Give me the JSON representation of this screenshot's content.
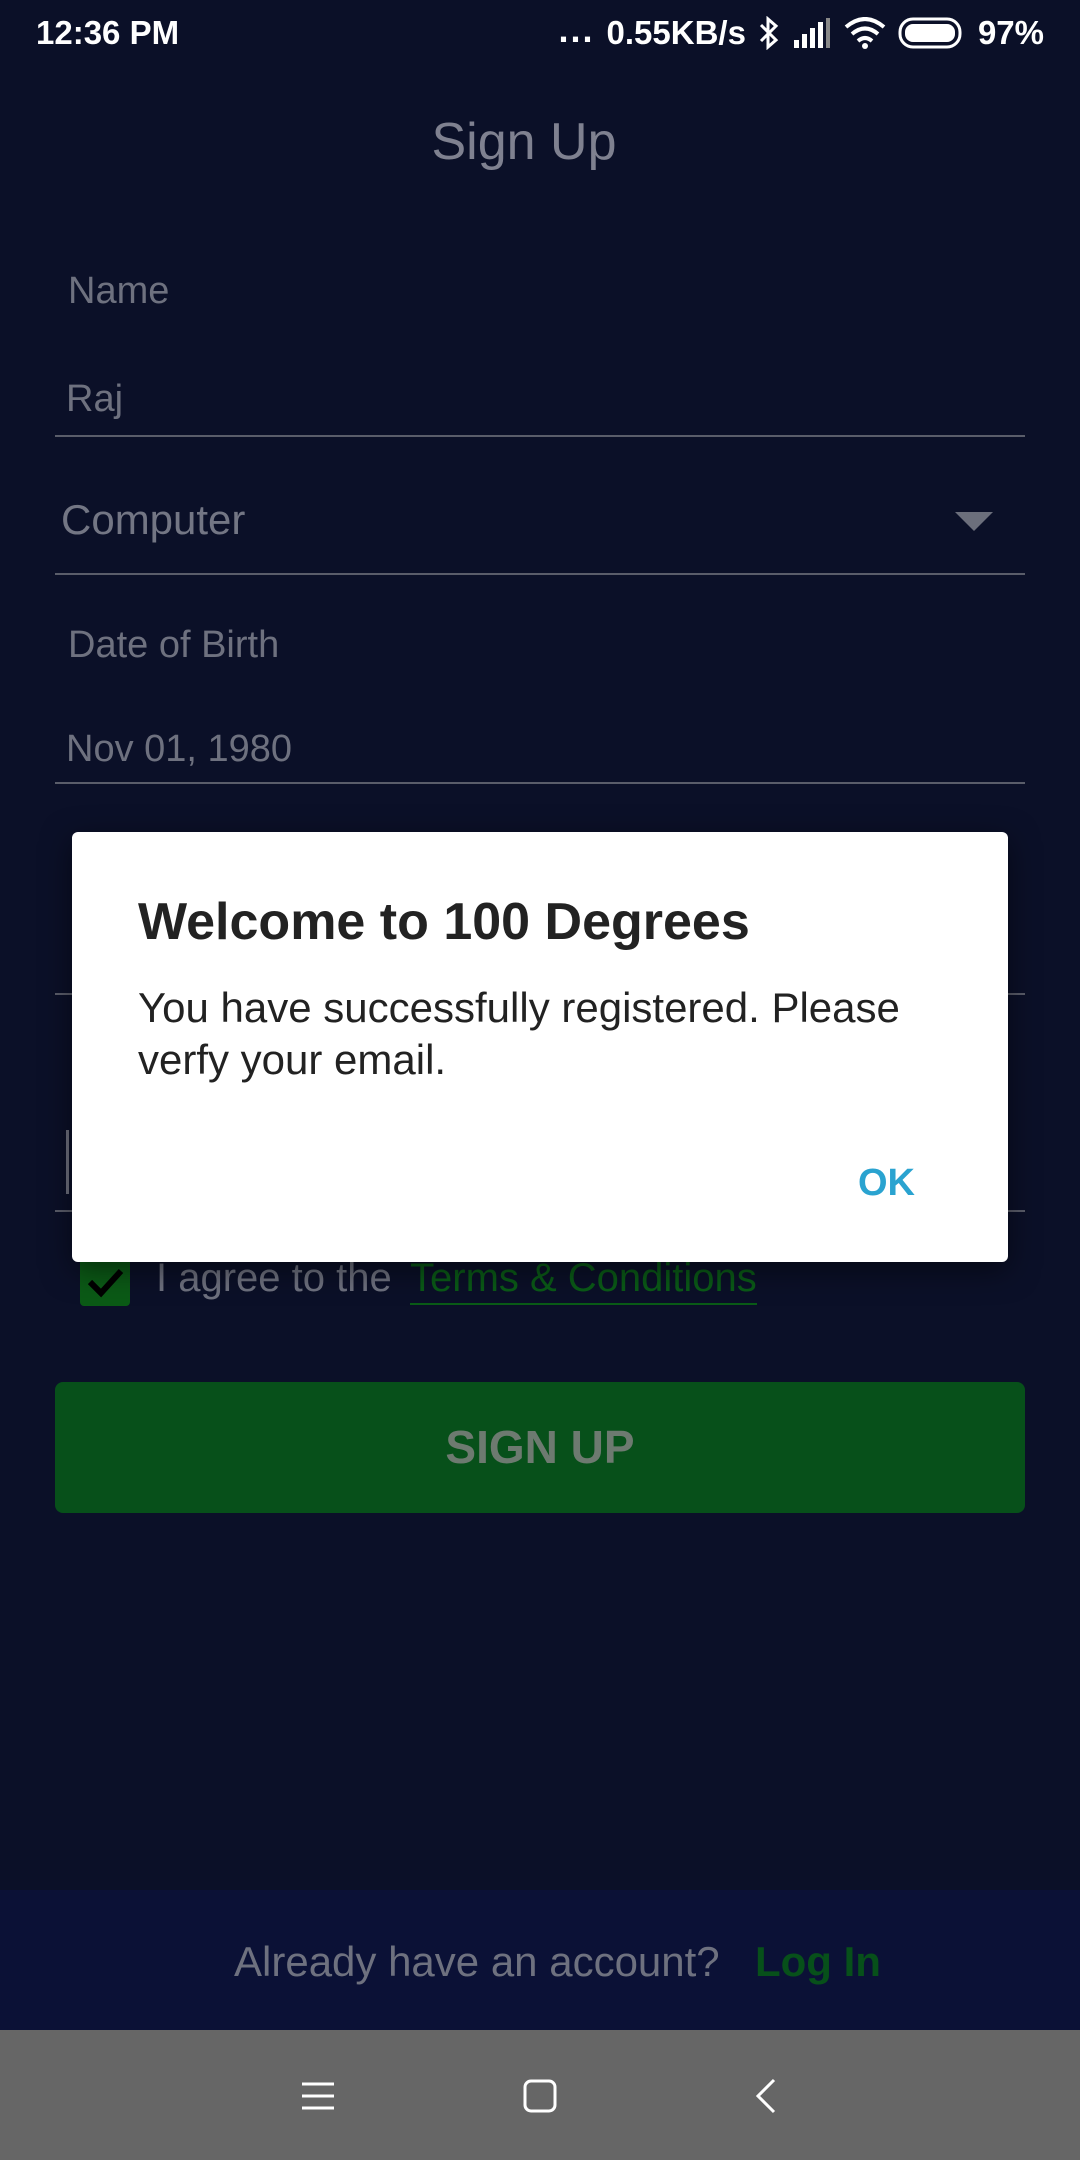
{
  "status_bar": {
    "time": "12:36 PM",
    "dots": "...",
    "network_speed": "0.55KB/s",
    "battery_percent": "97%"
  },
  "page": {
    "title": "Sign Up"
  },
  "form": {
    "name_label": "Name",
    "name_value": "Raj",
    "department_value": "Computer",
    "dob_label": "Date of Birth",
    "dob_value": "Nov 01, 1980"
  },
  "terms": {
    "prefix": "I agree to the",
    "link": "Terms & Conditions"
  },
  "signup_button": {
    "label": "SIGN UP"
  },
  "footer": {
    "prompt": "Already have an account?",
    "login_link": "Log In"
  },
  "dialog": {
    "title": "Welcome to 100 Degrees",
    "message": "You have successfully registered. Please verfy your email.",
    "ok_label": "OK"
  },
  "colors": {
    "background": "#0b1028",
    "accent_green": "#07501a",
    "dialog_button": "#2aa3d0"
  },
  "icons": {
    "checkbox": "checkmark-icon",
    "dropdown": "triangle-down-icon",
    "nav": [
      "menu-icon",
      "home-square-icon",
      "back-chevron-icon"
    ]
  }
}
